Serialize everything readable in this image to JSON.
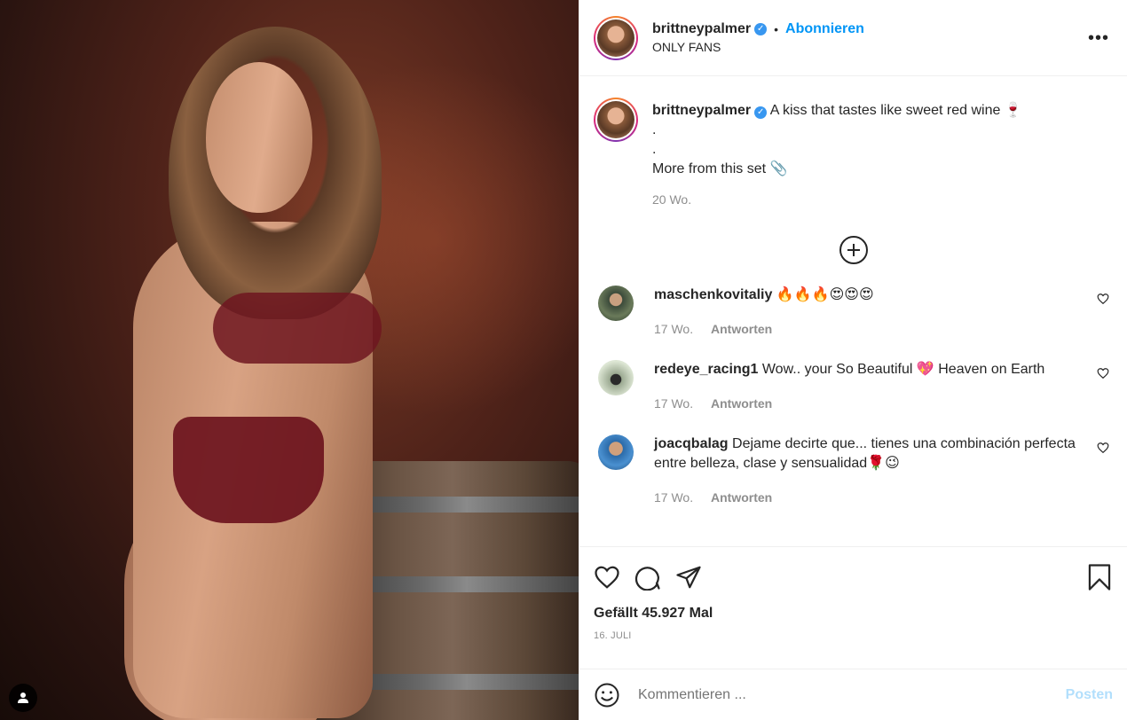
{
  "header": {
    "username": "brittneypalmer",
    "separator": "•",
    "follow_label": "Abonnieren",
    "location": "ONLY FANS",
    "more_icon": "more-horizontal-icon"
  },
  "caption": {
    "username": "brittneypalmer",
    "text": "A kiss that tastes like sweet red wine 🍷",
    "line2": ".",
    "line3": ".",
    "line4": "More from this set 📎",
    "time": "20 Wo."
  },
  "comments": [
    {
      "username": "maschenkovitaliy",
      "text": "🔥🔥🔥😍😍😍",
      "time": "17 Wo.",
      "reply": "Antworten"
    },
    {
      "username": "redeye_racing1",
      "text": "Wow.. your So Beautiful 💖 Heaven on Earth",
      "time": "17 Wo.",
      "reply": "Antworten"
    },
    {
      "username": "joacqbalag",
      "text": "Dejame decirte que... tienes una combinación perfecta entre belleza, clase y sensualidad🌹😉",
      "time": "17 Wo.",
      "reply": "Antworten"
    }
  ],
  "actions": {
    "likes": "Gefällt 45.927 Mal",
    "date": "16. JULI"
  },
  "add_comment": {
    "placeholder": "Kommentieren ...",
    "post_label": "Posten"
  },
  "colors": {
    "accent": "#0095f6",
    "verified": "#3897f0",
    "muted": "#8e8e8e",
    "post_disabled": "#b2dffc"
  }
}
